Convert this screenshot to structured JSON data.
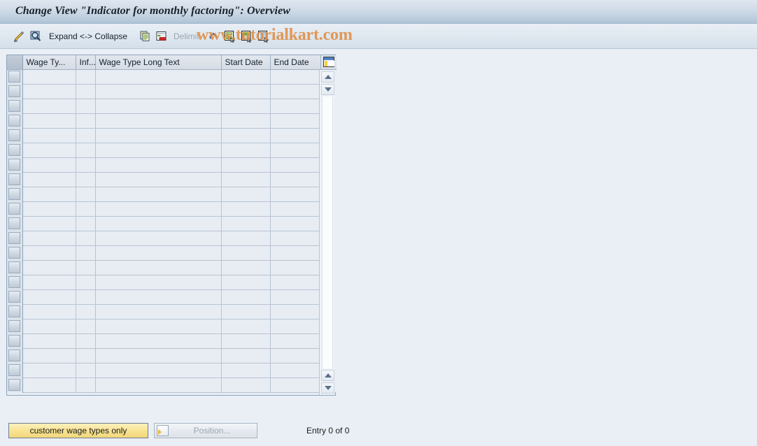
{
  "window": {
    "title": "Change View \"Indicator for monthly factoring\": Overview"
  },
  "watermark": {
    "text": "www.tutorialkart.com",
    "color": "#e08a3c"
  },
  "toolbar": {
    "items": [
      {
        "name": "display-change-icon",
        "icon": "pencil-icon",
        "label": ""
      },
      {
        "name": "check-icon",
        "icon": "magnifier-icon",
        "label": ""
      },
      {
        "name": "expand-collapse",
        "icon": "",
        "label": "Expand <-> Collapse"
      },
      {
        "name": "copy-as-icon",
        "icon": "copy-icon",
        "label": ""
      },
      {
        "name": "delete-icon",
        "icon": "delete-row-icon",
        "label": ""
      },
      {
        "name": "delimit-button",
        "icon": "",
        "label": "Delimit"
      },
      {
        "name": "undo-icon",
        "icon": "undo-icon",
        "label": ""
      },
      {
        "name": "select-all-icon",
        "icon": "document-green-icon",
        "label": ""
      },
      {
        "name": "select-block-icon",
        "icon": "document-green2-icon",
        "label": ""
      },
      {
        "name": "deselect-all-icon",
        "icon": "document-lines-icon",
        "label": ""
      }
    ]
  },
  "table": {
    "columns": [
      {
        "key": "selector",
        "label": ""
      },
      {
        "key": "wage_type",
        "label": "Wage Ty..."
      },
      {
        "key": "infotype",
        "label": "Inf..."
      },
      {
        "key": "long_text",
        "label": "Wage Type Long Text"
      },
      {
        "key": "start_date",
        "label": "Start Date"
      },
      {
        "key": "end_date",
        "label": "End Date"
      },
      {
        "key": "settings",
        "label": ""
      }
    ],
    "rows": [],
    "row_count": 22,
    "settings_icon": "table-settings-icon"
  },
  "footer": {
    "customer_wage_types_button": "customer wage types only",
    "position_button": "Position...",
    "position_icon": "position-icon",
    "entry_status": "Entry 0 of 0"
  },
  "colors": {
    "title_bar": "#cfdbe7",
    "page_background": "#eaeff5",
    "table_cell": "#e8edf4",
    "accent_yellow": "#f8e493",
    "watermark_orange": "#e08a3c"
  }
}
